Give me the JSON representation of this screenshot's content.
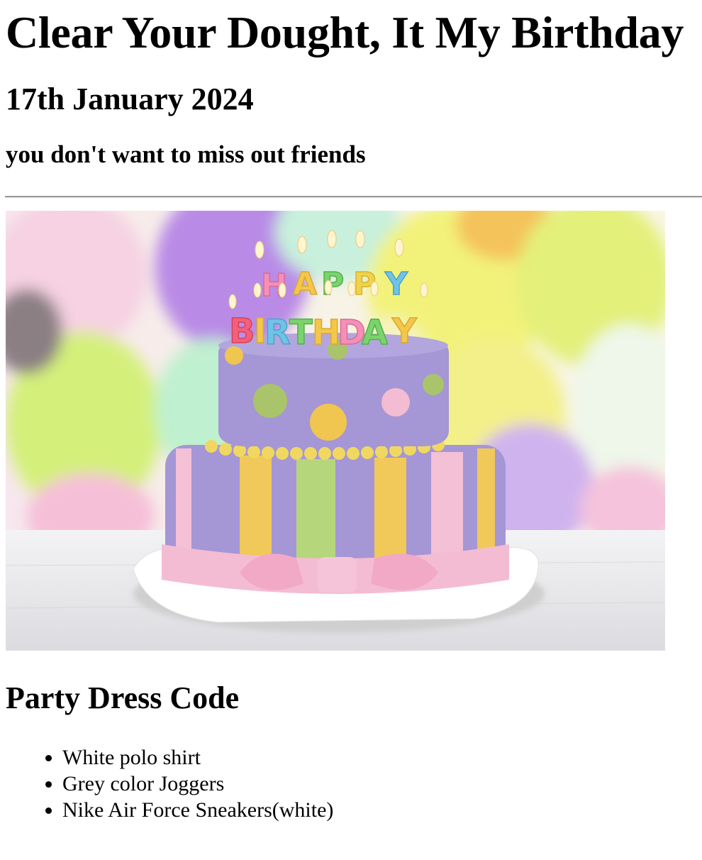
{
  "page": {
    "title": "Clear Your Dought, It My Birthday",
    "date": "17th January 2024",
    "tagline": "you don't want to miss out friends"
  },
  "hero_image": {
    "alt": "Birthday cake",
    "candle_text_top": "HAPPY",
    "candle_text_bottom": "BIRTHDAY",
    "colors": {
      "balloon_purple": "#b98be6",
      "balloon_yellow": "#f2f27a",
      "balloon_green": "#d4f07a",
      "balloon_pink": "#f4cfe0",
      "cake_purple": "#a596d6",
      "stripe_yellow": "#f1c85a",
      "stripe_green": "#b6d67c",
      "stripe_pink": "#f3c0d6",
      "ribbon_pink": "#f4bcd2",
      "table": "#e9e9ec"
    }
  },
  "dress_code": {
    "heading": "Party Dress Code",
    "items": [
      "White polo shirt",
      "Grey color Joggers",
      "Nike Air Force Sneakers(white)"
    ]
  }
}
